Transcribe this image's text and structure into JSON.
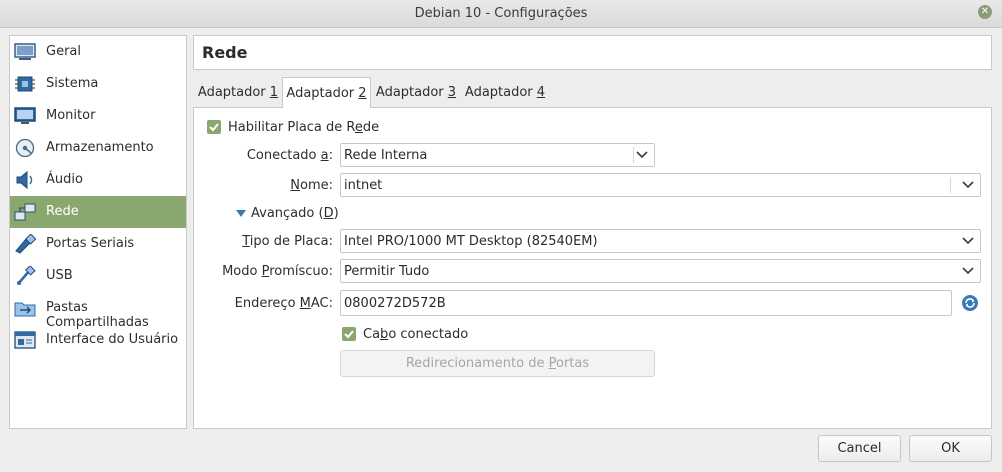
{
  "window": {
    "title": "Debian 10 - Configurações"
  },
  "sidebar": {
    "items": [
      {
        "label": "Geral",
        "icon": "monitor-general-icon"
      },
      {
        "label": "Sistema",
        "icon": "chip-icon"
      },
      {
        "label": "Monitor",
        "icon": "display-icon"
      },
      {
        "label": "Armazenamento",
        "icon": "disk-icon"
      },
      {
        "label": "Áudio",
        "icon": "speaker-icon"
      },
      {
        "label": "Rede",
        "icon": "network-icon",
        "selected": true
      },
      {
        "label": "Portas Seriais",
        "icon": "serial-port-icon"
      },
      {
        "label": "USB",
        "icon": "usb-icon"
      },
      {
        "label": "Pastas Compartilhadas",
        "icon": "shared-folder-icon"
      },
      {
        "label": "Interface do Usuário",
        "icon": "user-interface-icon"
      }
    ]
  },
  "page": {
    "title": "Rede"
  },
  "tabs": [
    {
      "pre": "Adaptador ",
      "key": "1"
    },
    {
      "pre": "Adaptador ",
      "key": "2",
      "active": true
    },
    {
      "pre": "Adaptador ",
      "key": "3"
    },
    {
      "pre": "Adaptador ",
      "key": "4"
    }
  ],
  "form": {
    "enable": {
      "pre": "Habilitar Placa de R",
      "key": "e",
      "post": "de",
      "checked": true
    },
    "attached": {
      "pre": "Conectado ",
      "key": "a",
      "post": ":",
      "value": "Rede Interna"
    },
    "name": {
      "pre": "",
      "key": "N",
      "post": "ome:",
      "value": "intnet"
    },
    "advanced": {
      "pre": "Avançado (",
      "key": "D",
      "post": ")"
    },
    "adapter_type": {
      "pre": "",
      "key": "T",
      "post": "ipo de Placa:",
      "value": "Intel PRO/1000 MT Desktop (82540EM)"
    },
    "promiscuous": {
      "pre": "Modo ",
      "key": "P",
      "post": "romíscuo:",
      "value": "Permitir Tudo"
    },
    "mac": {
      "pre": "Endereço ",
      "key": "M",
      "post": "AC:",
      "value": "0800272D572B"
    },
    "cable": {
      "pre": "Ca",
      "key": "b",
      "post": "o conectado",
      "checked": true
    },
    "port_forwarding": {
      "pre": "Redirecionamento de ",
      "key": "P",
      "post": "ortas"
    }
  },
  "buttons": {
    "cancel": "Cancel",
    "ok": "OK"
  },
  "colors": {
    "accent": "#8aa86e"
  }
}
